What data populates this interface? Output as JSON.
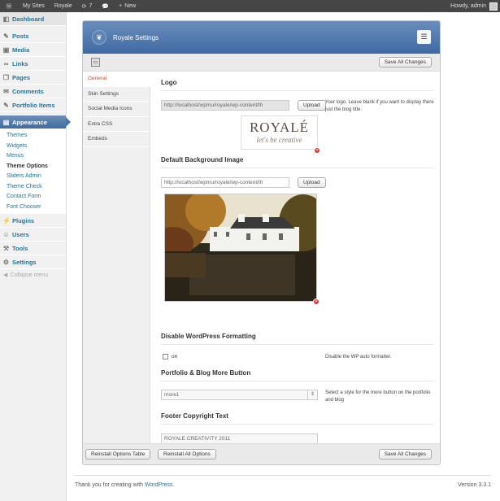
{
  "adminbar": {
    "sites": "My Sites",
    "site": "Royale",
    "updates": "7",
    "new": "New",
    "howdy": "Howdy, admin"
  },
  "menu": {
    "dashboard": "Dashboard",
    "posts": "Posts",
    "media": "Media",
    "links": "Links",
    "pages": "Pages",
    "comments": "Comments",
    "portfolio": "Portfolio Items",
    "appearance": "Appearance",
    "sub": [
      "Themes",
      "Widgets",
      "Menus",
      "Theme Options",
      "Sliders Admin",
      "Theme Check",
      "Contact Form",
      "Font Chooser"
    ],
    "plugins": "Plugins",
    "users": "Users",
    "tools": "Tools",
    "settings": "Settings",
    "collapse": "Collapse menu"
  },
  "panel": {
    "title": "Royale Settings",
    "save_all": "Save All Changes",
    "tabs": [
      "General",
      "Skin Settings",
      "Social Media Icons",
      "Extra CSS",
      "Embeds"
    ],
    "logo": {
      "heading": "Logo",
      "value": "http://localhost/wpmu/royale/wp-content/th",
      "upload": "Upload",
      "desc": "Your logo. Leave blank if you want to display there just the blog title.",
      "brand": "ROYALÉ",
      "tagline": "let's be creative"
    },
    "bg": {
      "heading": "Default Background Image",
      "value": "http://localhost/wpmu/royale/wp-content/th",
      "upload": "Upload"
    },
    "fmt": {
      "heading": "Disable WordPress Formatting",
      "checkbox_label": "on",
      "desc": "Disable the WP auto formatter."
    },
    "more": {
      "heading": "Portfolio & Blog More Button",
      "value": "more1",
      "desc": "Select a style for the more button on the portfolio and blog"
    },
    "copy": {
      "heading": "Footer Copyright Text",
      "value": "ROYALE CREATIVITY 2011"
    },
    "reinstall_table": "Reinstall Options Table",
    "reinstall_all": "Reinstall All Options"
  },
  "footer": {
    "thanks": "Thank you for creating with ",
    "wp": "WordPress",
    "dot": ".",
    "version": "Version 3.3.1"
  }
}
